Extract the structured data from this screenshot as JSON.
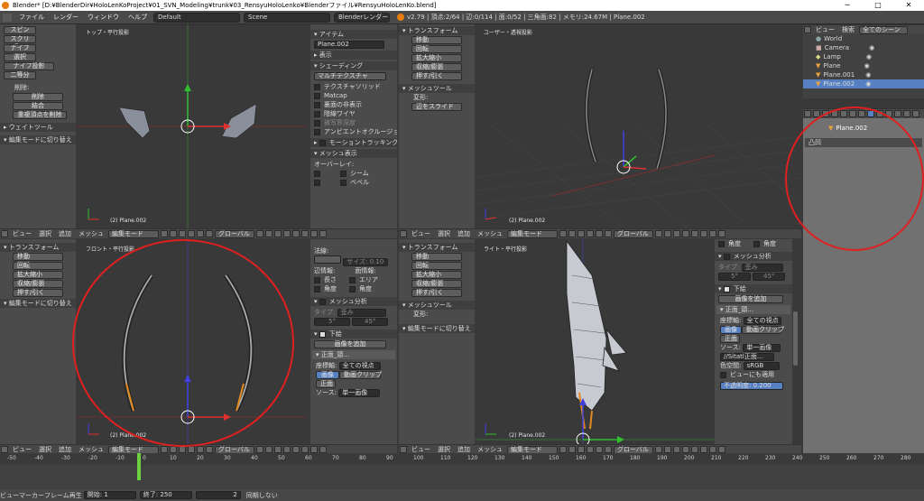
{
  "window": {
    "title": "Blender* [D:¥BlenderDir¥HoloLenKoProject¥01_SVN_Modeling¥trunk¥03_RensyuHoloLenko¥Blenderファイル¥RensyuHoloLenKo.blend]",
    "minimize": "─",
    "maximize": "□",
    "close": "✕"
  },
  "topbar": {
    "menus": [
      "ファイル",
      "レンダー",
      "ウィンドウ",
      "ヘルプ"
    ],
    "screen": "Default",
    "scene": "Scene",
    "engine": "Blenderレンダー",
    "stats": "v2.79 | 頂点:2/64 | 辺:0/114 | 面:0/52 | 三角面:82 | メモリ:24.67M | Plane.002"
  },
  "tl": {
    "label": "トップ・平行投影",
    "object": "(2) Plane.002",
    "tools": [
      "スピン",
      "スクリュー",
      "ナイフ",
      "選択",
      "ナイフ投影",
      "二等分"
    ],
    "remove_label": "削除:",
    "remove_items": [
      "削除",
      "結合",
      "重複頂点を削除"
    ],
    "weight_tools": "ウェイトツール",
    "edit_toggle": "編集モードに切り替え",
    "n_item": "アイテム",
    "n_name": "Plane.002",
    "n_display": "表示",
    "n_shading": "シェーディング",
    "n_multitex": "マルチテクスチャ",
    "n_checks": [
      "テクスチャソリッド",
      "Matcap",
      "裏面の非表示",
      "陰線ワイヤ",
      "被写界深度",
      "アンビエントオクルージョン(AO)"
    ],
    "n_motion": "モーショントラッキング",
    "n_mesh_display": "メッシュ表示",
    "n_overlay": "オーバーレイ:",
    "n_seam": "シーム",
    "n_bevel": "ベベル"
  },
  "tr": {
    "label": "ユーザー・透視投影",
    "object": "(2) Plane.002",
    "transform": "トランスフォーム",
    "tools": [
      "移動",
      "回転",
      "拡大縮小",
      "収縮/膨張",
      "押す/引く"
    ],
    "mesh_tools": "メッシュツール",
    "deform": "変形:",
    "slide": "辺をスライド"
  },
  "bl": {
    "label": "フロント・平行投影",
    "object": "(2) Plane.002",
    "transform": "トランスフォーム",
    "tools": [
      "移動",
      "回転",
      "拡大縮小",
      "収縮/膨張",
      "押す/引く"
    ],
    "edit_toggle": "編集モードに切り替え",
    "normal": "法線:",
    "size": "サイズ: 0.10",
    "edge_info": "辺情報:",
    "face_info": "面情報:",
    "length": "長さ",
    "area": "エリア",
    "angle": "角度",
    "angle2": "角度",
    "mesh_analysis": "メッシュ分析",
    "type_label": "タイプ:",
    "type_val": "歪み",
    "deg1": "5°",
    "deg2": "45°",
    "bg": "下絵",
    "add_image": "画像を追加",
    "img_name": "正面_頭...",
    "axis_label": "座標軸:",
    "axis_val": "全ての視点",
    "image_btn": "画像",
    "movieclip_btn": "動画クリップ",
    "front": "正面",
    "source_label": "ソース:",
    "source_val": "単一画像"
  },
  "br": {
    "label": "ライト・平行投影",
    "object": "(2) Plane.002",
    "transform": "トランスフォーム",
    "tools": [
      "移動",
      "回転",
      "拡大縮小",
      "収縮/膨張",
      "押す/引く"
    ],
    "mesh_tools": "メッシュツール",
    "deform": "変形:",
    "edit_toggle": "編集モードに切り替え",
    "angle": "角度",
    "angle2": "角度",
    "mesh_analysis": "メッシュ分析",
    "type_label": "タイプ:",
    "type_val": "歪み",
    "deg1": "5°",
    "deg2": "45°",
    "bg": "下絵",
    "img_name": "正面_頭...",
    "add_image": "画像を追加",
    "axis_label": "座標軸:",
    "axis_val": "全ての視点",
    "image_btn": "画像",
    "movieclip_btn": "動画クリップ",
    "front": "正面",
    "source_label": "ソース:",
    "source_val": "単一画像",
    "file": "//Sitatl正面...",
    "colorspace_label": "色空間:",
    "colorspace_val": "sRGB",
    "view_also": "ビューにも適用",
    "opacity": "不透明度:",
    "opacity_val": "0.200"
  },
  "viewhdr": {
    "view": "ビュー",
    "select": "選択",
    "add": "追加",
    "mesh": "メッシュ",
    "mode": "編集モード",
    "orient": "グローバル"
  },
  "outliner": {
    "view": "ビュー",
    "search": "検索",
    "scenes": "全てのシーン",
    "items": [
      "World",
      "Camera",
      "Lamp",
      "Plane",
      "Plane.001",
      "Plane.002"
    ]
  },
  "props": {
    "object": "Plane.002",
    "label": "凸凹"
  },
  "timeline": {
    "ticks": [
      "-50",
      "-40",
      "-30",
      "-20",
      "-10",
      "0",
      "10",
      "20",
      "30",
      "40",
      "50",
      "60",
      "70",
      "80",
      "90",
      "100",
      "110",
      "120",
      "130",
      "140",
      "150",
      "160",
      "170",
      "180",
      "190",
      "200",
      "210",
      "220",
      "230",
      "240",
      "250",
      "260",
      "270",
      "280"
    ],
    "view": "ビュー",
    "marker": "マーカー",
    "frame": "フレーム",
    "play": "再生",
    "start_label": "開始:",
    "start": "1",
    "end_label": "終了:",
    "end": "250",
    "current": "2",
    "sync": "同期しない"
  },
  "colors": {
    "accent": "#5680c2",
    "bg": "#393939",
    "panel": "#4b4b4b",
    "circle": "#e02020"
  }
}
